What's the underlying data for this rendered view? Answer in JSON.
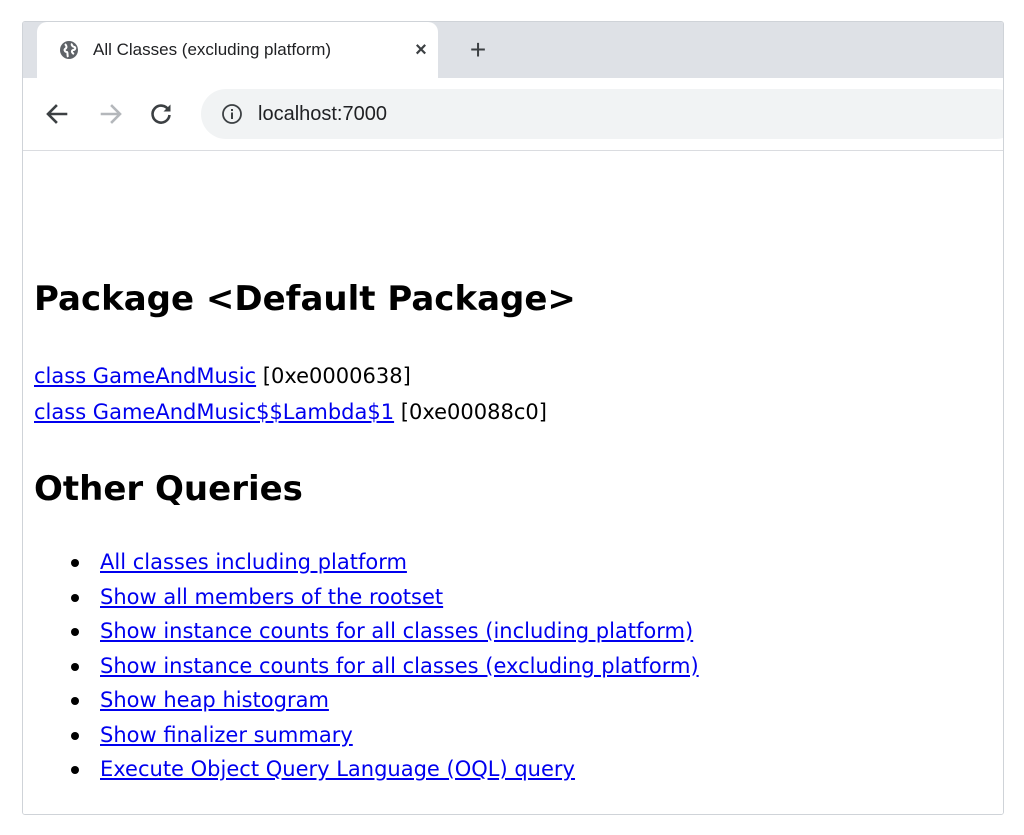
{
  "browser": {
    "tab_title": "All Classes (excluding platform)",
    "close_glyph": "×",
    "new_tab_glyph": "+",
    "url": "localhost:7000",
    "icons": {
      "tab_favicon": "globe-icon",
      "close": "close-icon",
      "new_tab": "plus-icon",
      "back": "arrow-left-icon",
      "forward": "arrow-right-icon",
      "reload": "reload-icon",
      "site_info": "info-icon"
    }
  },
  "page": {
    "package_heading": "Package <Default Package>",
    "classes": [
      {
        "name": "class GameAndMusic",
        "address": "[0xe0000638]"
      },
      {
        "name": "class GameAndMusic$$Lambda$1",
        "address": "[0xe00088c0]"
      }
    ],
    "other_heading": "Other Queries",
    "queries": [
      "All classes including platform",
      "Show all members of the rootset",
      "Show instance counts for all classes (including platform)",
      "Show instance counts for all classes (excluding platform)",
      "Show heap histogram",
      "Show finalizer summary",
      "Execute Object Query Language (OQL) query"
    ],
    "link_color": "#0000ee"
  }
}
